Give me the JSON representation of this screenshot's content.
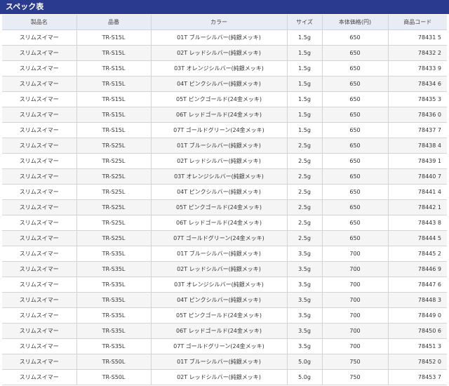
{
  "spec": {
    "title": "スペック表",
    "headers": {
      "name": "製品名",
      "code": "品番",
      "color": "カラー",
      "size": "サイズ",
      "price": "本体価格(円)",
      "jan": "商品コード"
    },
    "rows": [
      {
        "name": "スリムスイマー",
        "code": "TR-S15L",
        "color": "01T ブルーシルバー(純銀メッキ)",
        "size": "1.5g",
        "price": "650",
        "jan": "78431 5"
      },
      {
        "name": "スリムスイマー",
        "code": "TR-S15L",
        "color": "02T レッドシルバー(純銀メッキ)",
        "size": "1.5g",
        "price": "650",
        "jan": "78432 2"
      },
      {
        "name": "スリムスイマー",
        "code": "TR-S15L",
        "color": "03T オレンジシルバー(純銀メッキ)",
        "size": "1.5g",
        "price": "650",
        "jan": "78433 9"
      },
      {
        "name": "スリムスイマー",
        "code": "TR-S15L",
        "color": "04T ピンクシルバー(純銀メッキ)",
        "size": "1.5g",
        "price": "650",
        "jan": "78434 6"
      },
      {
        "name": "スリムスイマー",
        "code": "TR-S15L",
        "color": "05T ピンクゴールド(24金メッキ)",
        "size": "1.5g",
        "price": "650",
        "jan": "78435 3"
      },
      {
        "name": "スリムスイマー",
        "code": "TR-S15L",
        "color": "06T レッドゴールド(24金メッキ)",
        "size": "1.5g",
        "price": "650",
        "jan": "78436 0"
      },
      {
        "name": "スリムスイマー",
        "code": "TR-S15L",
        "color": "07T ゴールドグリーン(24金メッキ)",
        "size": "1.5g",
        "price": "650",
        "jan": "78437 7"
      },
      {
        "name": "スリムスイマー",
        "code": "TR-S25L",
        "color": "01T ブルーシルバー(純銀メッキ)",
        "size": "2.5g",
        "price": "650",
        "jan": "78438 4"
      },
      {
        "name": "スリムスイマー",
        "code": "TR-S25L",
        "color": "02T レッドシルバー(純銀メッキ)",
        "size": "2.5g",
        "price": "650",
        "jan": "78439 1"
      },
      {
        "name": "スリムスイマー",
        "code": "TR-S25L",
        "color": "03T オレンジシルバー(純銀メッキ)",
        "size": "2.5g",
        "price": "650",
        "jan": "78440 7"
      },
      {
        "name": "スリムスイマー",
        "code": "TR-S25L",
        "color": "04T ピンクシルバー(純銀メッキ)",
        "size": "2.5g",
        "price": "650",
        "jan": "78441 4"
      },
      {
        "name": "スリムスイマー",
        "code": "TR-S25L",
        "color": "05T ピンクゴールド(24金メッキ)",
        "size": "2.5g",
        "price": "650",
        "jan": "78442 1"
      },
      {
        "name": "スリムスイマー",
        "code": "TR-S25L",
        "color": "06T レッドゴールド(24金メッキ)",
        "size": "2.5g",
        "price": "650",
        "jan": "78443 8"
      },
      {
        "name": "スリムスイマー",
        "code": "TR-S25L",
        "color": "07T ゴールドグリーン(24金メッキ)",
        "size": "2.5g",
        "price": "650",
        "jan": "78444 5"
      },
      {
        "name": "スリムスイマー",
        "code": "TR-S35L",
        "color": "01T ブルーシルバー(純銀メッキ)",
        "size": "3.5g",
        "price": "700",
        "jan": "78445 2"
      },
      {
        "name": "スリムスイマー",
        "code": "TR-S35L",
        "color": "02T レッドシルバー(純銀メッキ)",
        "size": "3.5g",
        "price": "700",
        "jan": "78446 9"
      },
      {
        "name": "スリムスイマー",
        "code": "TR-S35L",
        "color": "03T オレンジシルバー(純銀メッキ)",
        "size": "3.5g",
        "price": "700",
        "jan": "78447 6"
      },
      {
        "name": "スリムスイマー",
        "code": "TR-S35L",
        "color": "04T ピンクシルバー(純銀メッキ)",
        "size": "3.5g",
        "price": "700",
        "jan": "78448 3"
      },
      {
        "name": "スリムスイマー",
        "code": "TR-S35L",
        "color": "05T ピンクゴールド(24金メッキ)",
        "size": "3.5g",
        "price": "700",
        "jan": "78449 0"
      },
      {
        "name": "スリムスイマー",
        "code": "TR-S35L",
        "color": "06T レッドゴールド(24金メッキ)",
        "size": "3.5g",
        "price": "700",
        "jan": "78450 6"
      },
      {
        "name": "スリムスイマー",
        "code": "TR-S35L",
        "color": "07T ゴールドグリーン(24金メッキ)",
        "size": "3.5g",
        "price": "700",
        "jan": "78451 3"
      },
      {
        "name": "スリムスイマー",
        "code": "TR-S50L",
        "color": "01T ブルーシルバー(純銀メッキ)",
        "size": "5.0g",
        "price": "750",
        "jan": "78452 0"
      },
      {
        "name": "スリムスイマー",
        "code": "TR-S50L",
        "color": "02T レッドシルバー(純銀メッキ)",
        "size": "5.0g",
        "price": "750",
        "jan": "78453 7"
      }
    ]
  },
  "colors": {
    "header_bg": "#2a3b8f",
    "th_bg": "#e8ecf4",
    "row_alt_bg": "#f5f5f5"
  }
}
